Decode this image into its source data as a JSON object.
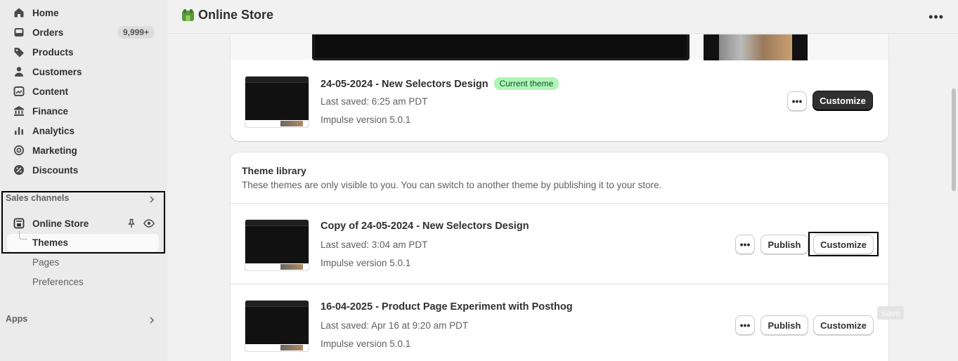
{
  "sidebar": {
    "items": [
      {
        "label": "Home",
        "icon": "home-icon"
      },
      {
        "label": "Orders",
        "icon": "inbox-icon",
        "badge": "9,999+"
      },
      {
        "label": "Products",
        "icon": "tag-icon"
      },
      {
        "label": "Customers",
        "icon": "person-icon"
      },
      {
        "label": "Content",
        "icon": "content-icon"
      },
      {
        "label": "Finance",
        "icon": "bank-icon"
      },
      {
        "label": "Analytics",
        "icon": "bar-chart-icon"
      },
      {
        "label": "Marketing",
        "icon": "target-icon"
      },
      {
        "label": "Discounts",
        "icon": "discount-icon"
      }
    ],
    "sales_channels_label": "Sales channels",
    "online_store_label": "Online Store",
    "sub_items": {
      "themes": "Themes",
      "pages": "Pages",
      "preferences": "Preferences"
    },
    "apps_label": "Apps"
  },
  "header": {
    "title": "Online Store"
  },
  "current_theme": {
    "name": "24-05-2024 - New Selectors Design",
    "badge": "Current theme",
    "saved": "Last saved: 6:25 am PDT",
    "version": "Impulse version 5.0.1",
    "customize_label": "Customize"
  },
  "library": {
    "title": "Theme library",
    "subtitle": "These themes are only visible to you. You can switch to another theme by publishing it to your store.",
    "themes": [
      {
        "name": "Copy of 24-05-2024 - New Selectors Design",
        "saved": "Last saved: 3:04 am PDT",
        "version": "Impulse version 5.0.1",
        "publish_label": "Publish",
        "customize_label": "Customize"
      },
      {
        "name": "16-04-2025 - Product Page Experiment with Posthog",
        "saved": "Last saved: Apr 16 at 9:20 am PDT",
        "version": "Impulse version 5.0.1",
        "publish_label": "Publish",
        "customize_label": "Customize"
      }
    ]
  },
  "save_ghost_label": "Save",
  "colors": {
    "accent_dark": "#303030",
    "badge_green": "#aff5b4",
    "sidebar_bg": "#ebebeb"
  }
}
